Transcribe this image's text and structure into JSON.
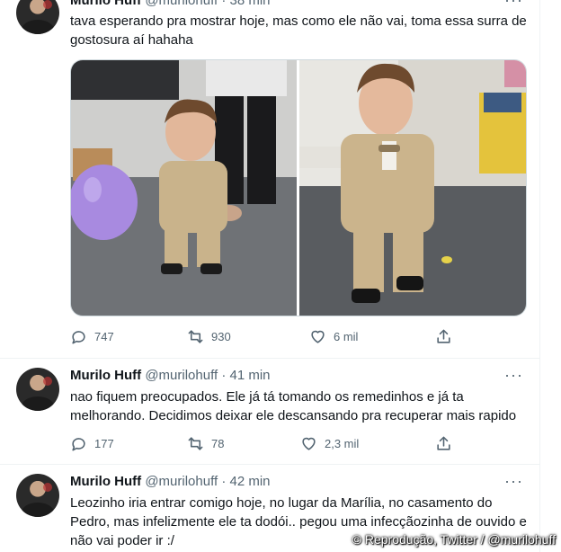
{
  "tweets": [
    {
      "author": "Murilo Huff",
      "handle": "@murilohuff",
      "time": "· 38 min",
      "text": "tava esperando pra mostrar hoje, mas como ele não vai, toma essa surra de gostosura aí hahaha",
      "replies": "747",
      "retweets": "930",
      "likes": "6 mil"
    },
    {
      "author": "Murilo Huff",
      "handle": "@murilohuff",
      "time": "· 41 min",
      "text": "nao fiquem preocupados. Ele já tá tomando os remedinhos e já ta melhorando. Decidimos deixar ele descansando pra recuperar mais rapido",
      "replies": "177",
      "retweets": "78",
      "likes": "2,3 mil"
    },
    {
      "author": "Murilo Huff",
      "handle": "@murilohuff",
      "time": "· 42 min",
      "text": "Leozinho iria entrar comigo hoje, no lugar da Marília, no casamento do Pedro, mas infelizmente ele ta dodói.. pegou uma infecçãozinha de ouvido e não vai poder ir :/"
    }
  ],
  "more_icon": "···",
  "credit": "© Reprodução, Twitter / @murilohuff",
  "colors": {
    "text": "#0f1419",
    "muted": "#536471",
    "border": "#eff3f4"
  }
}
